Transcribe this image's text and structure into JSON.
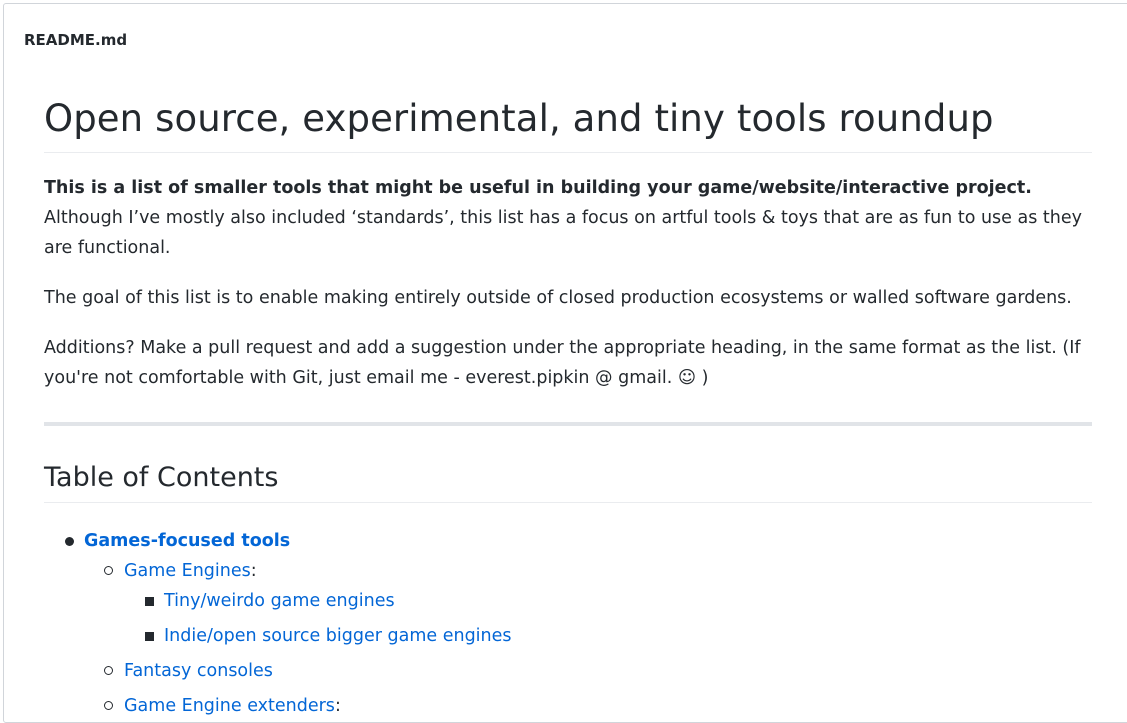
{
  "file_header": {
    "filename": "README.md"
  },
  "readme": {
    "title": "Open source, experimental, and tiny tools roundup",
    "intro_bold": "This is a list of smaller tools that might be useful in building your game/website/interactive project.",
    "intro_rest": " Although I’ve mostly also included ‘standards’, this list has a focus on artful tools & toys that are as fun to use as they are functional.",
    "goal": "The goal of this list is to enable making entirely outside of closed production ecosystems or walled software gardens.",
    "additions": "Additions? Make a pull request and add a suggestion under the appropriate heading, in the same format as the list. (If you're not comfortable with Git, just email me - everest.pipkin @ gmail. ☺ )",
    "toc_heading": "Table of Contents",
    "toc": {
      "games_focused": "Games-focused tools",
      "game_engines": "Game Engines",
      "game_engines_suffix": ":",
      "tiny_engines": "Tiny/weirdo game engines",
      "bigger_engines": "Indie/open source bigger game engines",
      "fantasy_consoles": "Fantasy consoles",
      "engine_extenders": "Game Engine extenders",
      "engine_extenders_suffix": ":"
    }
  }
}
